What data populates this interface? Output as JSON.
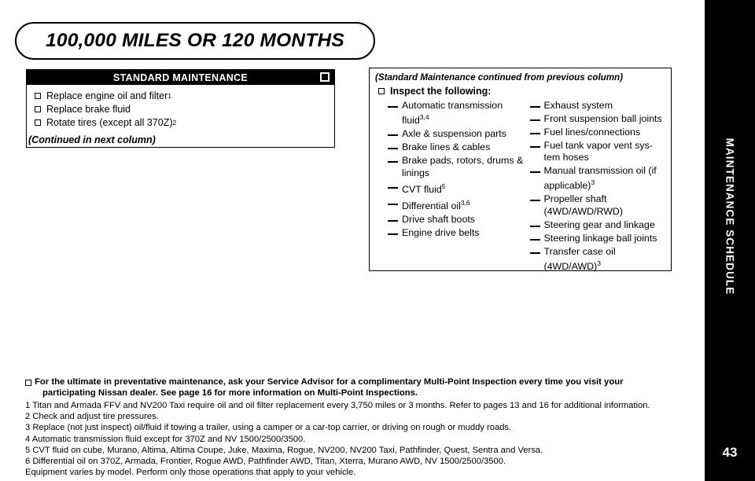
{
  "title": "100,000 MILES OR 120 MONTHS",
  "sidebar": {
    "label": "MAINTENANCE SCHEDULE",
    "page_number": "43",
    "color": "#000000"
  },
  "left_box": {
    "header": "STANDARD MAINTENANCE",
    "items": [
      {
        "text": "Replace engine oil and filter",
        "sup": "1"
      },
      {
        "text": "Replace brake fluid",
        "sup": ""
      },
      {
        "text": "Rotate tires (except all 370Z)",
        "sup": "2"
      }
    ],
    "continued_note": "(Continued in next column)"
  },
  "right_box": {
    "title": "(Standard Maintenance continued from previous column)",
    "inspect_label": "Inspect the following:",
    "column_1": [
      {
        "text": "Automatic transmission fluid",
        "sup": "3,4"
      },
      {
        "text": "Axle & suspension parts",
        "sup": ""
      },
      {
        "text": "Brake lines & cables",
        "sup": ""
      },
      {
        "text": "Brake pads, rotors, drums & linings",
        "sup": ""
      },
      {
        "text": "CVT fluid",
        "sup": "5"
      },
      {
        "text": "Differential oil",
        "sup": "3,6"
      },
      {
        "text": "Drive shaft boots",
        "sup": ""
      },
      {
        "text": "Engine drive belts",
        "sup": ""
      }
    ],
    "column_2": [
      {
        "text": "Exhaust system",
        "sup": ""
      },
      {
        "text": "Front suspension ball joints",
        "sup": ""
      },
      {
        "text": "Fuel lines/connections",
        "sup": ""
      },
      {
        "text": "Fuel tank vapor vent sys-tem hoses",
        "sup": ""
      },
      {
        "text": "Manual transmission oil (if applicable)",
        "sup": "3"
      },
      {
        "text": "Propeller shaft (4WD/AWD/RWD)",
        "sup": ""
      },
      {
        "text": "Steering gear and linkage",
        "sup": ""
      },
      {
        "text": "Steering linkage ball joints",
        "sup": ""
      },
      {
        "text": "Transfer case oil (4WD/AWD)",
        "sup": "3"
      }
    ]
  },
  "footnotes": {
    "highlight_line1": "For the ultimate in preventative maintenance, ask your Service Advisor for a complimentary Multi-Point Inspection every time you visit your",
    "highlight_line2": "participating Nissan dealer. See page 16 for more information on Multi-Point Inspections.",
    "notes": [
      "1 Titan and Armada FFV and NV200 Taxi require oil and oil filter replacement every 3,750 miles or 3 months. Refer to pages 13 and 16 for additional information.",
      "2 Check and adjust tire pressures.",
      "3 Replace (not just inspect) oil/fluid if towing a trailer, using a camper or a car-top carrier, or driving on rough or muddy roads.",
      "4 Automatic transmission fluid except for 370Z and NV 1500/2500/3500.",
      "5 CVT fluid on cube, Murano, Altima, Altima Coupe, Juke, Maxima, Rogue, NV200, NV200 Taxi, Pathfinder, Quest, Sentra and Versa.",
      "6 Differential oil on 370Z, Armada, Frontier, Rogue AWD, Pathfinder AWD, Titan, Xterra, Murano AWD, NV 1500/2500/3500.",
      "Equipment varies by model. Perform only those operations that apply to your vehicle."
    ]
  }
}
